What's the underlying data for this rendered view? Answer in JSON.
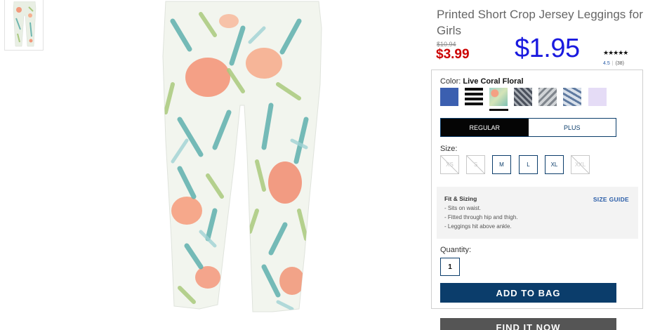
{
  "product": {
    "title": "Printed Short Crop Jersey Leggings for Girls",
    "old_price": "$10.94",
    "sale_price": "$3.99",
    "overlay_price": "$1.95",
    "stars": "★★★★★",
    "rating_value": "4.5",
    "rating_count": "(38)"
  },
  "color": {
    "label": "Color:",
    "selected": "Live Coral Floral",
    "swatches": [
      {
        "name": "blue",
        "hex": "#3b5fb0"
      },
      {
        "name": "black-stripe",
        "hex": "#111111"
      },
      {
        "name": "live-coral-floral",
        "hex": "#8fc4b8",
        "selected": true
      },
      {
        "name": "grey-floral-dark",
        "hex": "#6e7480"
      },
      {
        "name": "grey-floral-light",
        "hex": "#9aa0a8"
      },
      {
        "name": "blue-floral",
        "hex": "#7d93b3"
      },
      {
        "name": "lavender",
        "hex": "#e5dcf6"
      }
    ]
  },
  "fit_tabs": {
    "regular": "REGULAR",
    "plus": "PLUS"
  },
  "size": {
    "label": "Size:",
    "options": [
      {
        "label": "XS",
        "available": false
      },
      {
        "label": "S",
        "available": false
      },
      {
        "label": "M",
        "available": true
      },
      {
        "label": "L",
        "available": true
      },
      {
        "label": "XL",
        "available": true
      },
      {
        "label": "XXL",
        "available": false
      }
    ]
  },
  "fit_sizing": {
    "title": "Fit & Sizing",
    "guide_link": "SIZE GUIDE",
    "notes": [
      "- Sits on waist.",
      "- Fitted through hip and thigh.",
      "- Leggings hit above ankle."
    ]
  },
  "quantity": {
    "label": "Quantity:",
    "value": "1"
  },
  "buttons": {
    "add_to_bag": "ADD TO BAG",
    "find_it_now": "FIND IT NOW"
  },
  "colors": {
    "sale_red": "#cc0000",
    "navy": "#0b3d6b",
    "overlay_blue": "#1a1adf"
  }
}
